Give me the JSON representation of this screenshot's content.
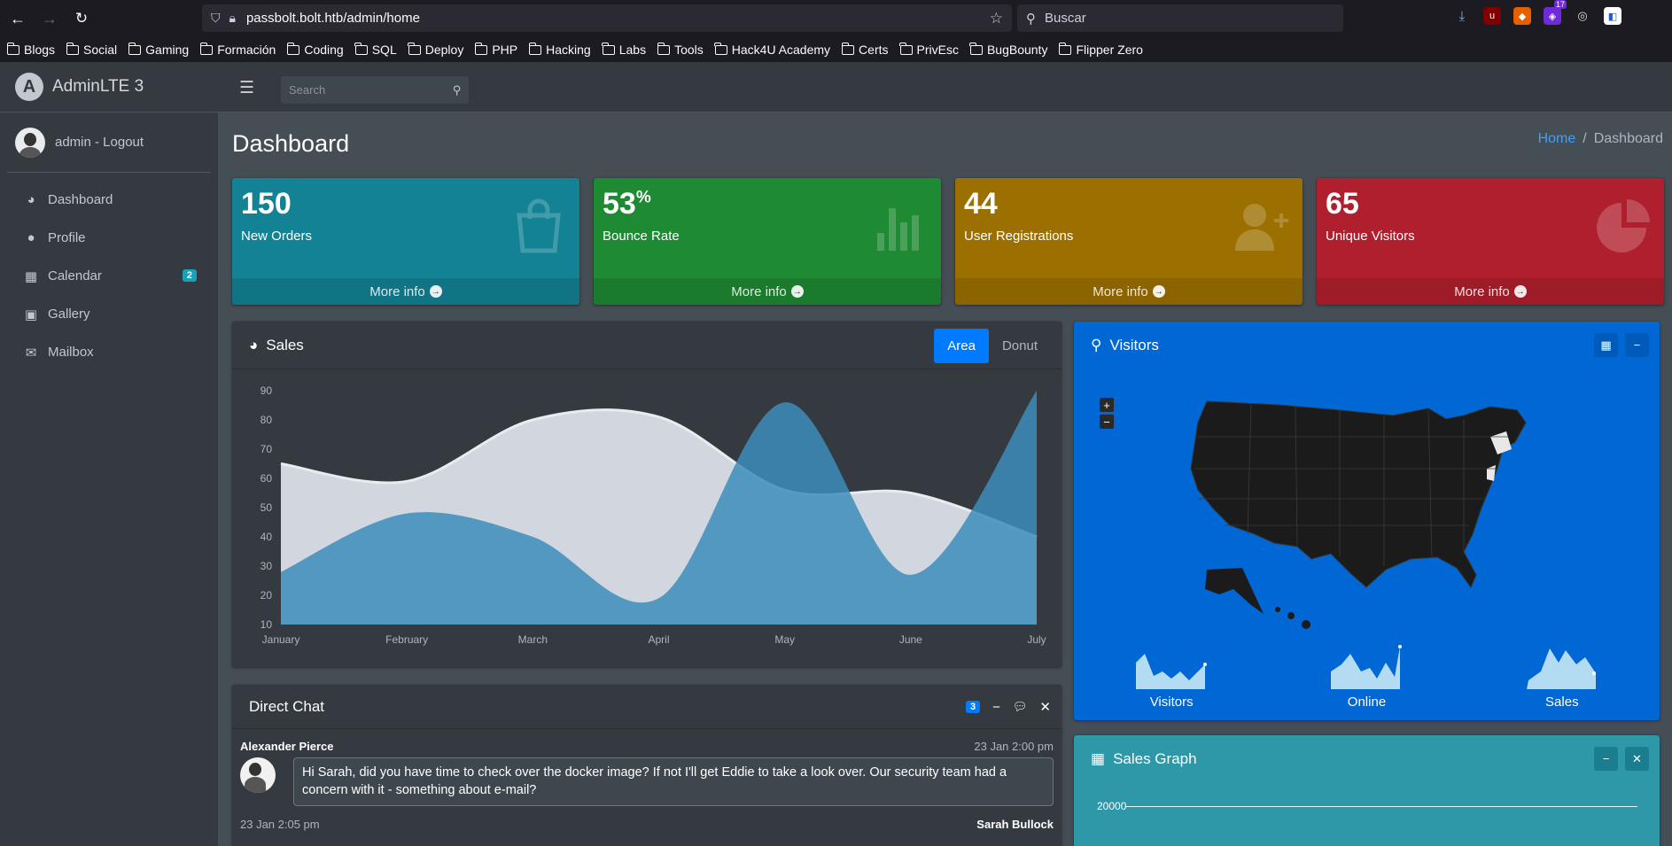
{
  "browser": {
    "url": "passbolt.bolt.htb/admin/home",
    "search_placeholder": "Buscar",
    "ext_badge": "17",
    "bookmarks": [
      "Blogs",
      "Social",
      "Gaming",
      "Formación",
      "Coding",
      "SQL",
      "Deploy",
      "PHP",
      "Hacking",
      "Labs",
      "Tools",
      "Hack4U Academy",
      "Certs",
      "PrivEsc",
      "BugBounty",
      "Flipper Zero"
    ]
  },
  "brand": {
    "text": "AdminLTE 3"
  },
  "user": {
    "name": "admin - Logout"
  },
  "sidebar": {
    "items": [
      {
        "label": "Dashboard",
        "icon": "tachometer-icon"
      },
      {
        "label": "Profile",
        "icon": "user-icon"
      },
      {
        "label": "Calendar",
        "icon": "calendar-icon",
        "badge": "2"
      },
      {
        "label": "Gallery",
        "icon": "image-icon"
      },
      {
        "label": "Mailbox",
        "icon": "envelope-icon"
      }
    ]
  },
  "topnav": {
    "search_placeholder": "Search"
  },
  "page": {
    "title": "Dashboard",
    "breadcrumb": {
      "home": "Home",
      "separator": "/",
      "current": "Dashboard"
    }
  },
  "stats": [
    {
      "value": "150",
      "sup": "",
      "label": "New Orders",
      "link": "More info",
      "color": "#138294",
      "icon": "shopping-bag-icon"
    },
    {
      "value": "53",
      "sup": "%",
      "label": "Bounce Rate",
      "link": "More info",
      "color": "#1e8a33",
      "icon": "bar-chart-icon"
    },
    {
      "value": "44",
      "sup": "",
      "label": "User Registrations",
      "link": "More info",
      "color": "#9b7000",
      "icon": "user-plus-icon"
    },
    {
      "value": "65",
      "sup": "",
      "label": "Unique Visitors",
      "link": "More info",
      "color": "#b01f2d",
      "icon": "pie-chart-icon"
    }
  ],
  "sales": {
    "title": "Sales",
    "tabs": [
      "Area",
      "Donut"
    ],
    "active_tab": "Area"
  },
  "chart_data": {
    "type": "area",
    "categories": [
      "January",
      "February",
      "March",
      "April",
      "May",
      "June",
      "July"
    ],
    "series": [
      {
        "values": [
          28,
          48,
          40,
          19,
          86,
          27,
          90
        ],
        "color": "#3c8dbc"
      },
      {
        "values": [
          65,
          59,
          80,
          81,
          56,
          55,
          40
        ],
        "color": "#d2d6de"
      }
    ],
    "ylim": [
      10,
      90
    ],
    "yticks": [
      10,
      20,
      30,
      40,
      50,
      60,
      70,
      80,
      90
    ]
  },
  "visitors": {
    "title": "Visitors",
    "sparklines": [
      "Visitors",
      "Online",
      "Sales"
    ],
    "zoom_in": "+",
    "zoom_out": "−"
  },
  "chat": {
    "title": "Direct Chat",
    "badge": "3",
    "messages": [
      {
        "name": "Alexander Pierce",
        "time": "23 Jan 2:00 pm",
        "text": "Hi Sarah, did you have time to check over the docker image? If not I'll get Eddie to take a look over. Our security team had a concern with it - something about e-mail?"
      },
      {
        "name": "Sarah Bullock",
        "time": "23 Jan 2:05 pm"
      }
    ]
  },
  "sales_graph": {
    "title": "Sales Graph",
    "tick": "20000"
  }
}
